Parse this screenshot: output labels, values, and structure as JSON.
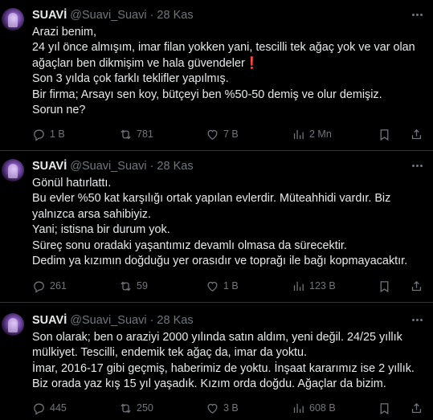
{
  "tweets": [
    {
      "name": "SUAVİ",
      "handle": "@Suavi_Suavi",
      "separator": "·",
      "date": "28 Kas",
      "lines": [
        "Arazi benim,",
        "24 yıl önce almışım, imar filan yokken yani, tescilli tek ağaç yok ve var olan",
        "ağaçları ben dikmişim ve hala güvendeler❗",
        "Son 3 yılda çok farklı teklifler yapılmış.",
        "Bir firma; Arsayı sen koy, bütçeyi ben %50-50 demiş ve olur demişiz.",
        "Sorun ne?"
      ],
      "replies": "1 B",
      "retweets": "781",
      "likes": "7 B",
      "views": "2 Mn"
    },
    {
      "name": "SUAVİ",
      "handle": "@Suavi_Suavi",
      "separator": "·",
      "date": "28 Kas",
      "lines": [
        "Gönül hatırlattı.",
        "Bu evler %50 kat karşılığı ortak yapılan evlerdir. Müteahhidi vardır. Biz",
        "yalnızca arsa sahibiyiz.",
        "Yani; istisna bir durum yok.",
        "Süreç sonu oradaki yaşantımız devamlı olmasa da sürecektir.",
        "Dedim ya kızımın doğduğu yer orasıdır ve toprağı ile bağı kopmayacaktır."
      ],
      "replies": "261",
      "retweets": "59",
      "likes": "1 B",
      "views": "123 B"
    },
    {
      "name": "SUAVİ",
      "handle": "@Suavi_Suavi",
      "separator": "·",
      "date": "28 Kas",
      "lines": [
        "Son olarak; ben o araziyi 2000 yılında satın aldım, yeni değil. 24/25 yıllık",
        "mülkiyet. Tescilli, endemik tek ağaç da, imar da yoktu.",
        "İmar, 2016-17 gibi geçmiş, haberimiz de yoktu. İnşaat kararımız ise 2 yıllık.",
        "Biz orada yaz kış 15 yıl yaşadık. Kızım orda doğdu. Ağaçlar da bizim."
      ],
      "replies": "445",
      "retweets": "250",
      "likes": "3 B",
      "views": "608 B"
    }
  ],
  "icons": [
    "reply-icon",
    "retweet-icon",
    "like-icon",
    "views-icon",
    "bookmark-icon",
    "share-icon",
    "more-icon"
  ],
  "colors": {
    "background": "#000000",
    "text": "#e7e9ea",
    "secondary": "#71767b",
    "divider": "#2f3336"
  }
}
